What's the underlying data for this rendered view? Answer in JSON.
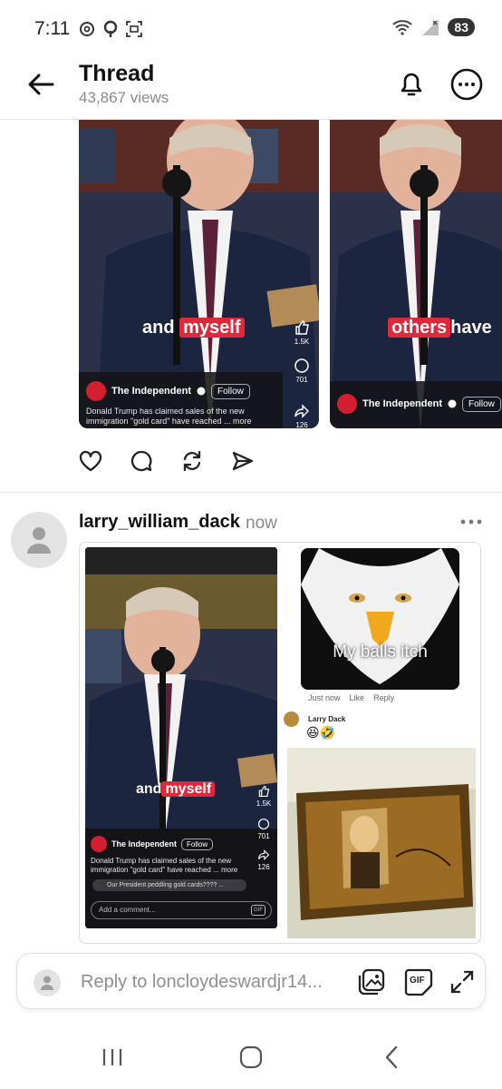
{
  "status_bar": {
    "time": "7:11",
    "battery": "83",
    "left_icons": [
      "threads-icon",
      "p-icon",
      "scan-icon"
    ],
    "right_icons": [
      "wifi-icon",
      "signal-icon"
    ]
  },
  "header": {
    "title": "Thread",
    "views": "43,867 views"
  },
  "carousel": {
    "items": [
      {
        "caption_plain": "and",
        "caption_highlight": "myself",
        "publisher": "The Independent",
        "follow_label": "Follow",
        "description_line1": "Donald Trump has claimed sales of the new",
        "description_line2": "immigration \"gold card\" have reached ... more",
        "likes": "1.5K",
        "comments": "701",
        "shares": "126"
      },
      {
        "caption_highlight": "others",
        "caption_plain": "have",
        "publisher": "The Independent",
        "follow_label": "Follow"
      }
    ]
  },
  "comment": {
    "username": "larry_william_dack",
    "time": "now",
    "screenshot": {
      "caption_plain": "and",
      "caption_highlight": "myself",
      "publisher": "The Independent",
      "follow_label": "Follow",
      "description_line1": "Donald Trump has claimed sales of the new",
      "description_line2": "immigration \"gold card\" have reached ... more",
      "likes": "1.5K",
      "comments": "701",
      "shares": "126",
      "comment_preview": "Our President peddling gold cards???? ...",
      "add_comment_placeholder": "Add a comment...",
      "gif_label": "GIF"
    },
    "meme": {
      "caption": "My balls itch",
      "meta_time": "Just now",
      "meta_like": "Like",
      "meta_reply": "Reply",
      "reply_user": "Larry Dack",
      "reply_emojis": "😆🤣"
    }
  },
  "reply_bar": {
    "placeholder": "Reply to loncloydeswardjr14...",
    "gif_label": "GIF"
  },
  "colors": {
    "highlight_red": "#e0283a",
    "muted_text": "#8a8a8a"
  }
}
